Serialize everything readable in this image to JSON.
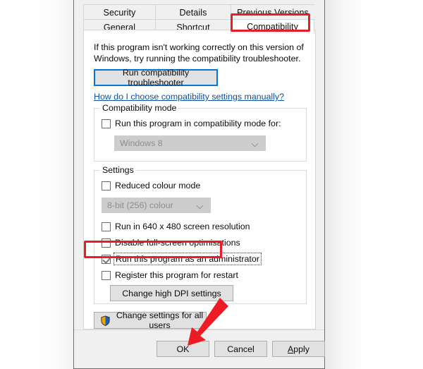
{
  "dialog": {
    "tabs_row1": [
      {
        "label": "Security",
        "selected": false
      },
      {
        "label": "Details",
        "selected": false
      },
      {
        "label": "Previous Versions",
        "selected": false
      }
    ],
    "tabs_row2": [
      {
        "label": "General",
        "selected": false
      },
      {
        "label": "Shortcut",
        "selected": false
      },
      {
        "label": "Compatibility",
        "selected": true
      }
    ],
    "intro_text": "If this program isn't working correctly on this version of Windows, try running the compatibility troubleshooter.",
    "troubleshoot_button": "Run compatibility troubleshooter",
    "help_link": "How do I choose compatibility settings manually?",
    "compatibility_mode": {
      "legend": "Compatibility mode",
      "checkbox_label": "Run this program in compatibility mode for:",
      "checkbox_checked": false,
      "combo_value": "Windows 8",
      "combo_disabled": true
    },
    "settings": {
      "legend": "Settings",
      "reduced_colour_label": "Reduced colour mode",
      "reduced_colour_checked": false,
      "colour_depth_value": "8-bit (256) colour",
      "colour_depth_disabled": true,
      "items": [
        {
          "label": "Run in 640 x 480 screen resolution",
          "checked": false
        },
        {
          "label": "Disable full-screen optimisations",
          "checked": false
        },
        {
          "label": "Run this program as an administrator",
          "checked": true,
          "focused": true,
          "highlighted": true
        },
        {
          "label": "Register this program for restart",
          "checked": false
        }
      ],
      "dpi_button": "Change high DPI settings"
    },
    "all_users_button": "Change settings for all users",
    "all_users_icon": "uac-shield-icon",
    "footer": {
      "ok": "OK",
      "cancel": "Cancel",
      "apply_accel": "A",
      "apply_rest": "pply"
    }
  },
  "annotations": {
    "tab_highlight_color": "#ed1c24",
    "admin_highlight_color": "#ed1c24",
    "arrow_color": "#ed1c24",
    "focus_border_color": "#0078d7"
  }
}
